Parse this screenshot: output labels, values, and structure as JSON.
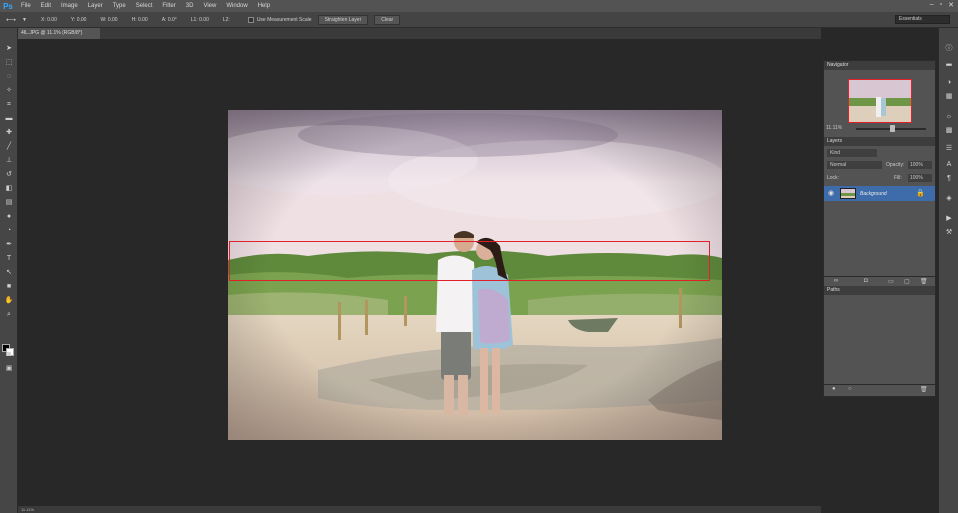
{
  "app": {
    "logo": "Ps"
  },
  "menu": [
    "File",
    "Edit",
    "Image",
    "Layer",
    "Type",
    "Select",
    "Filter",
    "3D",
    "View",
    "Window",
    "Help"
  ],
  "window_controls": [
    "–",
    "▫",
    "✕"
  ],
  "options": {
    "tool_preset": "▼",
    "x": "X: 0.00",
    "y": "Y: 0.00",
    "w": "W: 0.00",
    "h": "H: 0.00",
    "a": "A: 0.0°",
    "l1": "L1: 0.00",
    "l2": "L2:",
    "use_scale_label": "Use Measurement Scale",
    "straighten_btn": "Straighten Layer",
    "clear_btn": "Clear",
    "workspace": "Essentials"
  },
  "document": {
    "tab_label": "4IL.JPG @ 11.1% (RGB/8*)",
    "status_text": "11.11%"
  },
  "panels": {
    "navigator_tab": "Navigator",
    "zoom_value": "11.11%",
    "layers_tab": "Layers",
    "filter_kind": "Kind",
    "blend_mode": "Normal",
    "opacity_label": "Opacity:",
    "opacity_value": "100%",
    "lock_label": "Lock:",
    "fill_label": "Fill:",
    "fill_value": "100%",
    "layer_name": "Background",
    "paths_tab": "Paths"
  },
  "colors": {
    "accent": "#3e6cab",
    "selection": "#e0202a",
    "bg": "#282828"
  }
}
